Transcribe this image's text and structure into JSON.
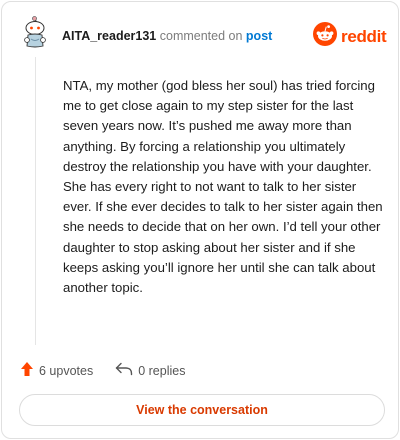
{
  "comment": {
    "username": "AITA_reader131",
    "commented_on": "commented on",
    "post_link": "post",
    "body": "NTA, my mother (god bless her soul) has tried forcing me to get close again to my step sister for the last seven years now. It’s pushed me away more than anything. By forcing a relationship you ultimately destroy the relationship you have with your daughter. She has every right to not want to talk to her sister ever. If she ever decides to talk to her sister again then she needs to decide that on her own. I’d tell your other daughter to stop asking about her sister and if she keeps asking you’ll ignore her until she can talk about another topic."
  },
  "brand": {
    "wordmark": "reddit",
    "color": "#ff4500",
    "icon": "reddit-snoo-icon"
  },
  "actions": {
    "upvotes": "6 upvotes",
    "replies": "0 replies",
    "upvote_icon": "upvote-arrow-icon",
    "reply_icon": "reply-arrow-icon",
    "upvote_color": "#ff4500"
  },
  "cta": {
    "label": "View the conversation",
    "color": "#d93a00"
  },
  "colors": {
    "link": "#0079d3",
    "muted": "#7c7c7c"
  }
}
